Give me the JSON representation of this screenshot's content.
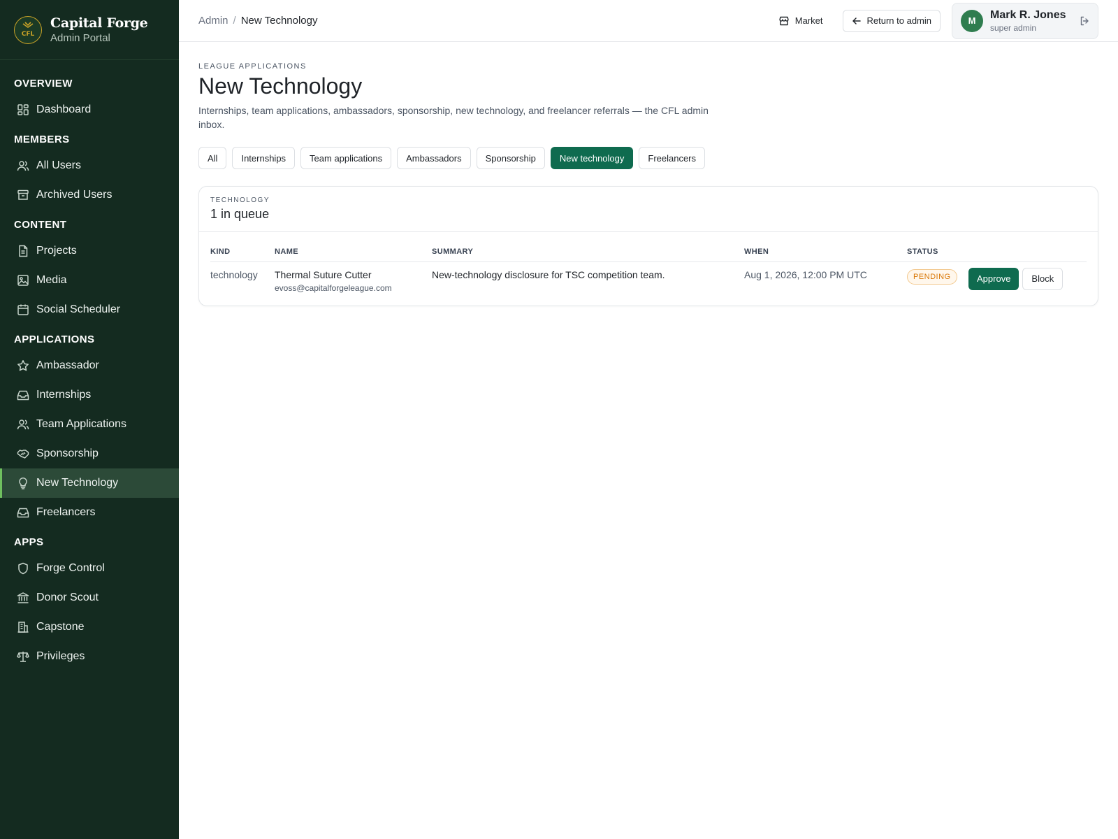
{
  "brand": {
    "name": "Capital Forge",
    "subtitle": "Admin Portal",
    "logo_text": "CFL",
    "accent_color": "#c9a227"
  },
  "sidebar": {
    "sections": [
      {
        "title": "OVERVIEW",
        "items": [
          {
            "label": "Dashboard",
            "icon": "dashboard-icon"
          }
        ]
      },
      {
        "title": "MEMBERS",
        "items": [
          {
            "label": "All Users",
            "icon": "users-icon"
          },
          {
            "label": "Archived Users",
            "icon": "archive-icon"
          }
        ]
      },
      {
        "title": "CONTENT",
        "items": [
          {
            "label": "Projects",
            "icon": "file-icon"
          },
          {
            "label": "Media",
            "icon": "image-icon"
          },
          {
            "label": "Social Scheduler",
            "icon": "calendar-icon"
          }
        ]
      },
      {
        "title": "APPLICATIONS",
        "items": [
          {
            "label": "Ambassador",
            "icon": "star-icon"
          },
          {
            "label": "Internships",
            "icon": "inbox-icon"
          },
          {
            "label": "Team Applications",
            "icon": "users-icon"
          },
          {
            "label": "Sponsorship",
            "icon": "handshake-icon"
          },
          {
            "label": "New Technology",
            "icon": "lightbulb-icon",
            "active": true
          },
          {
            "label": "Freelancers",
            "icon": "inbox-icon"
          }
        ]
      },
      {
        "title": "APPS",
        "items": [
          {
            "label": "Forge Control",
            "icon": "shield-icon"
          },
          {
            "label": "Donor Scout",
            "icon": "bank-icon"
          },
          {
            "label": "Capstone",
            "icon": "building-icon"
          },
          {
            "label": "Privileges",
            "icon": "scale-icon"
          }
        ]
      }
    ]
  },
  "header": {
    "breadcrumb_root": "Admin",
    "breadcrumb_sep": "/",
    "breadcrumb_current": "New Technology",
    "market_label": "Market",
    "return_label": "Return to admin",
    "user": {
      "initial": "M",
      "name": "Mark R. Jones",
      "role": "super admin"
    }
  },
  "page": {
    "eyebrow": "LEAGUE APPLICATIONS",
    "title": "New Technology",
    "description": "Internships, team applications, ambassadors, sponsorship, new technology, and freelancer referrals — the CFL admin inbox."
  },
  "filters": [
    {
      "label": "All"
    },
    {
      "label": "Internships"
    },
    {
      "label": "Team applications"
    },
    {
      "label": "Ambassadors"
    },
    {
      "label": "Sponsorship"
    },
    {
      "label": "New technology",
      "active": true
    },
    {
      "label": "Freelancers"
    }
  ],
  "queue": {
    "eyebrow": "TECHNOLOGY",
    "title": "1 in queue",
    "columns": {
      "kind": "KIND",
      "name": "NAME",
      "summary": "SUMMARY",
      "when": "WHEN",
      "status": "STATUS"
    },
    "rows": [
      {
        "kind": "technology",
        "name": "Thermal Suture Cutter",
        "email": "evoss@capitalforgeleague.com",
        "summary": "New-technology disclosure for TSC competition team.",
        "when": "Aug 1, 2026, 12:00 PM UTC",
        "status": "PENDING",
        "approve_label": "Approve",
        "block_label": "Block"
      }
    ]
  },
  "colors": {
    "sidebar_bg": "#142b20",
    "primary": "#0f6b4f",
    "active_indicator": "#6fbf5f",
    "pending": "#d97706"
  }
}
